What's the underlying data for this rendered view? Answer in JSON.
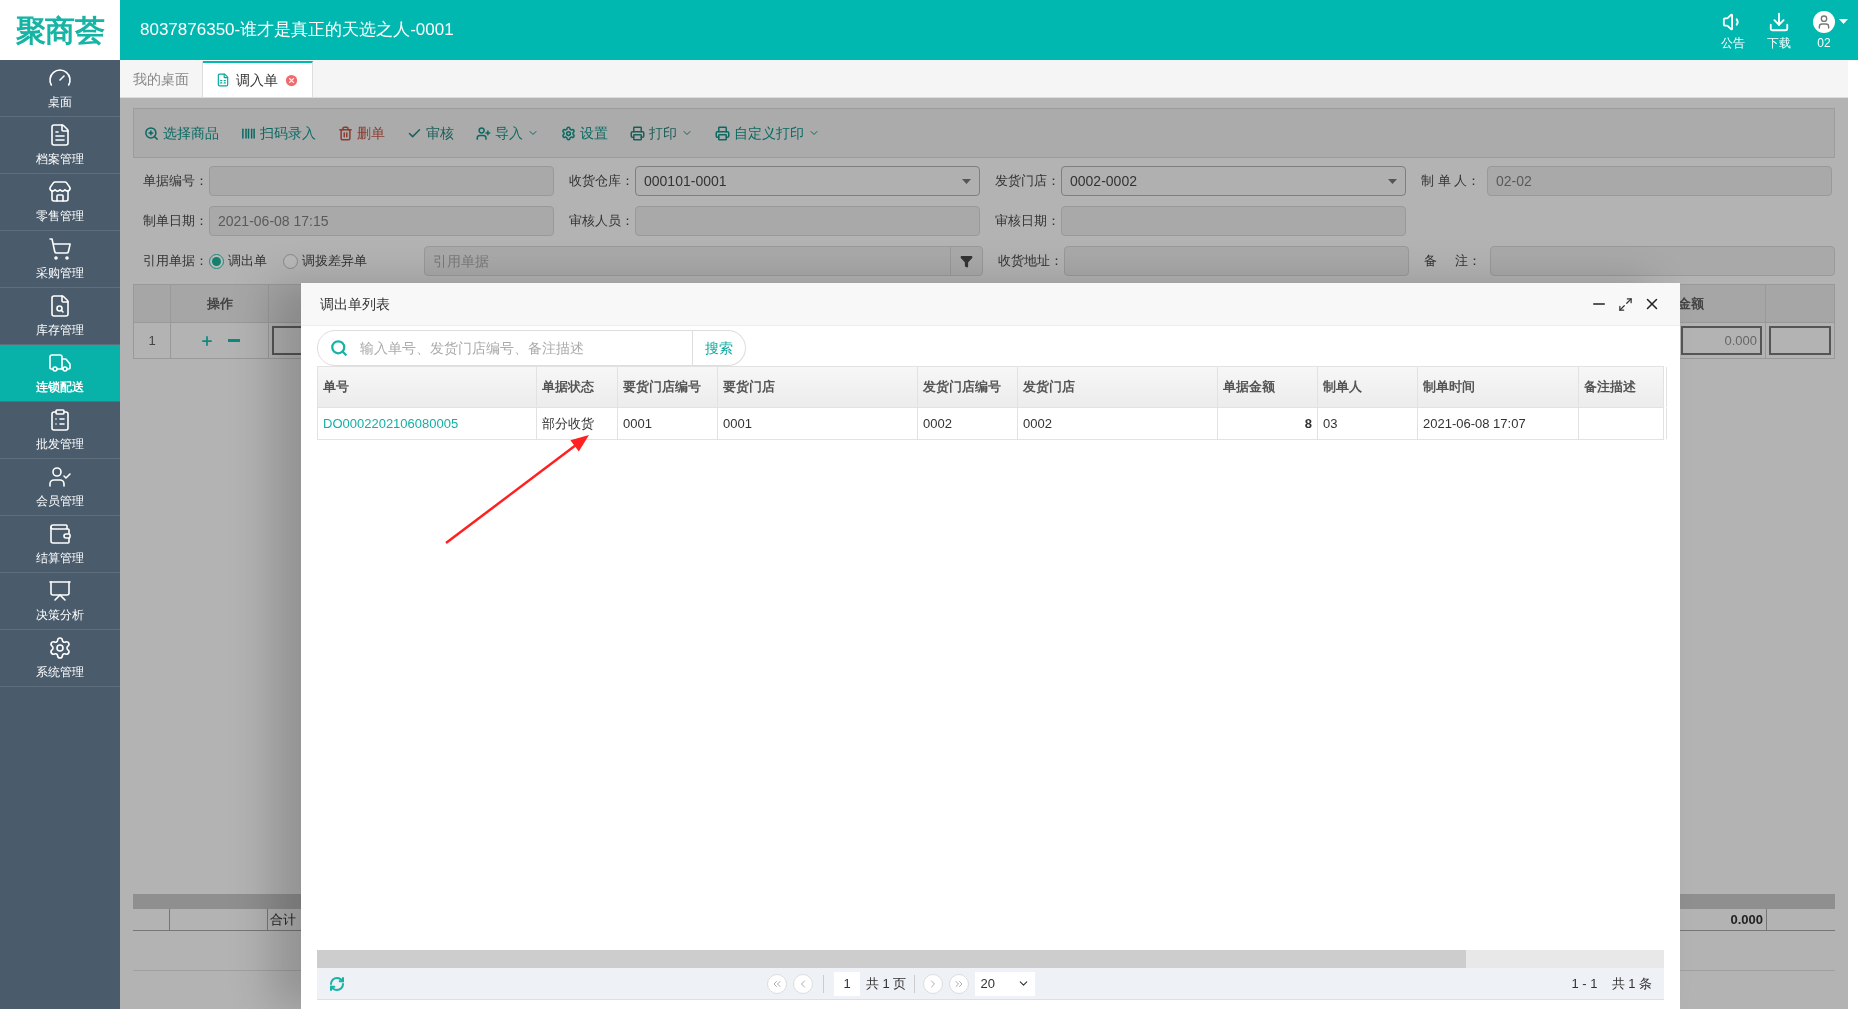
{
  "header": {
    "logo": "聚商荟",
    "title": "8037876350-谁才是真正的天选之人-0001",
    "actions": [
      {
        "label": "公告",
        "dropdown": false
      },
      {
        "label": "下载",
        "dropdown": false
      },
      {
        "label": "02",
        "dropdown": true
      }
    ]
  },
  "sidebar": {
    "items": [
      {
        "label": "桌面",
        "selected": false
      },
      {
        "label": "档案管理",
        "selected": false
      },
      {
        "label": "零售管理",
        "selected": false
      },
      {
        "label": "采购管理",
        "selected": false
      },
      {
        "label": "库存管理",
        "selected": false
      },
      {
        "label": "连锁配送",
        "selected": true
      },
      {
        "label": "批发管理",
        "selected": false
      },
      {
        "label": "会员管理",
        "selected": false
      },
      {
        "label": "结算管理",
        "selected": false
      },
      {
        "label": "决策分析",
        "selected": false
      },
      {
        "label": "系统管理",
        "selected": false
      }
    ]
  },
  "tabs": [
    {
      "label": "我的桌面",
      "selected": false,
      "closable": false
    },
    {
      "label": "调入单",
      "selected": true,
      "closable": true
    }
  ],
  "toolbar": [
    {
      "label": "选择商品",
      "kind": "normal",
      "disabled": false,
      "dropdown": false
    },
    {
      "label": "扫码录入",
      "kind": "normal",
      "disabled": false,
      "dropdown": false
    },
    {
      "label": "删单",
      "kind": "danger",
      "disabled": true,
      "dropdown": false
    },
    {
      "label": "审核",
      "kind": "normal",
      "disabled": true,
      "dropdown": false
    },
    {
      "label": "导入",
      "kind": "normal",
      "disabled": false,
      "dropdown": true
    },
    {
      "label": "设置",
      "kind": "normal",
      "disabled": false,
      "dropdown": false
    },
    {
      "label": "打印",
      "kind": "normal",
      "disabled": true,
      "dropdown": true
    },
    {
      "label": "自定义打印",
      "kind": "normal",
      "disabled": false,
      "dropdown": true
    }
  ],
  "form": {
    "rows": [
      [
        {
          "kind": "text",
          "label": "单据编号："
        },
        {
          "kind": "select",
          "label": "收货仓库：",
          "value": "000101-0001"
        },
        {
          "kind": "select",
          "label": "发货门店：",
          "value": "0002-0002"
        },
        {
          "kind": "text",
          "label": "制 单 人：",
          "value": "02-02"
        }
      ],
      [
        {
          "kind": "text",
          "label": "制单日期：",
          "value": "2021-06-08 17:15"
        },
        {
          "kind": "text",
          "label": "审核人员："
        },
        {
          "kind": "text",
          "label": "审核日期："
        }
      ],
      [
        {
          "kind": "radios",
          "label": "引用单据：",
          "options": [
            {
              "label": "调出单",
              "selected": true
            },
            {
              "label": "调拨差异单",
              "selected": false
            }
          ]
        },
        {
          "kind": "reference",
          "placeholder": "引用单据"
        },
        {
          "kind": "text",
          "label": "收货地址："
        },
        {
          "kind": "text",
          "label": "备     注："
        }
      ]
    ]
  },
  "grid": {
    "columns": [
      "操作",
      "金额"
    ],
    "rows": [
      {
        "index": "1",
        "amount": "0.000"
      }
    ],
    "footer": {
      "label": "合计",
      "amount": "0.000"
    }
  },
  "dialog": {
    "title": "调出单列表",
    "search": {
      "placeholder": "输入单号、发货门店编号、备注描述",
      "button": "搜索"
    },
    "columns": [
      "单号",
      "单据状态",
      "要货门店编号",
      "要货门店",
      "发货门店编号",
      "发货门店",
      "单据金额",
      "制单人",
      "制单时间",
      "备注描述"
    ],
    "rows": [
      [
        "DO0002202106080005",
        "部分收货",
        "0001",
        "0001",
        "0002",
        "0002",
        "8",
        "03",
        "2021-06-08 17:07",
        null
      ]
    ],
    "pagination": {
      "page": "1",
      "pages": "共 1 页",
      "page_size": "20",
      "range": "1 - 1",
      "total": "共 1 条"
    }
  }
}
